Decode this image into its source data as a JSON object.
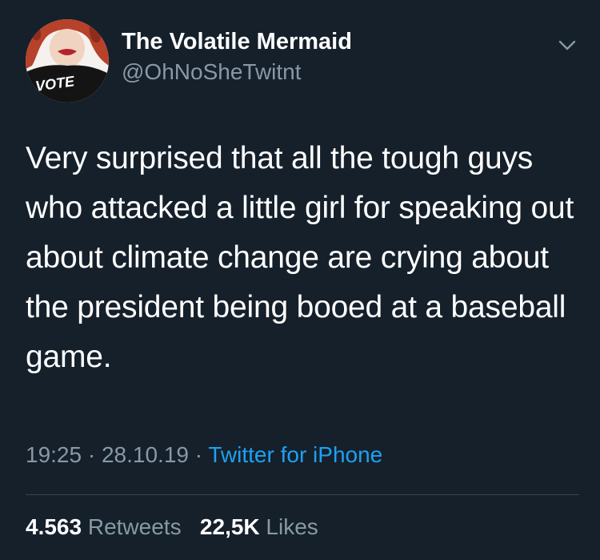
{
  "tweet": {
    "display_name": "The Volatile Mermaid",
    "handle": "@OhNoSheTwitnt",
    "avatar_text": "VOTE",
    "text": "Very surprised that all the tough guys who attacked a little girl for speaking out about climate change are crying about the president being booed at a baseball game.",
    "time": "19:25",
    "separator": "·",
    "date": "28.10.19",
    "source": "Twitter for iPhone",
    "retweets_count": "4.563",
    "retweets_label": "Retweets",
    "likes_count": "22,5K",
    "likes_label": "Likes"
  },
  "colors": {
    "background": "#15202b",
    "primary_text": "#ffffff",
    "secondary_text": "#8899a6",
    "link": "#1da1f2",
    "divider": "#38444d"
  },
  "icons": {
    "menu": "chevron-down-icon"
  }
}
